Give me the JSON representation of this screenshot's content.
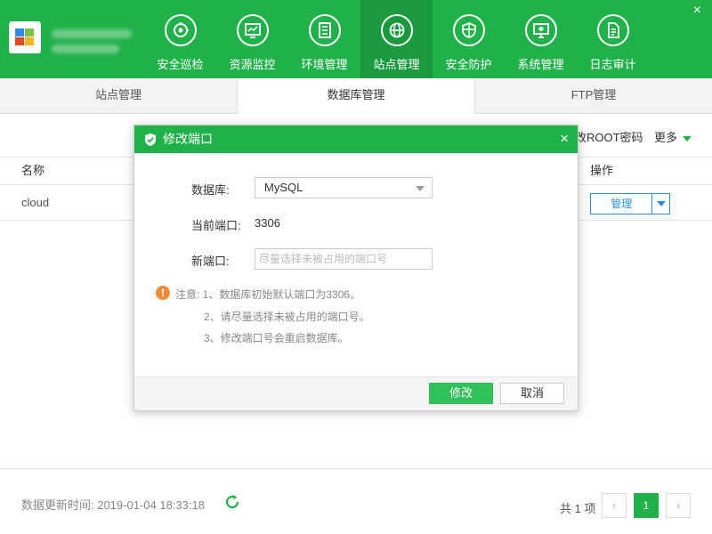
{
  "header": {
    "nav": [
      {
        "label": "安全巡检",
        "icon": "inspection-icon"
      },
      {
        "label": "资源监控",
        "icon": "monitor-icon"
      },
      {
        "label": "环境管理",
        "icon": "server-icon"
      },
      {
        "label": "站点管理",
        "icon": "globe-icon",
        "active": true
      },
      {
        "label": "安全防护",
        "icon": "shield-icon"
      },
      {
        "label": "系统管理",
        "icon": "settings-screen-icon"
      },
      {
        "label": "日志审计",
        "icon": "log-document-icon"
      }
    ],
    "close_label": "×"
  },
  "tabs": [
    {
      "label": "站点管理"
    },
    {
      "label": "数据库管理",
      "active": true
    },
    {
      "label": "FTP管理"
    }
  ],
  "toolbar": {
    "root_pwd_label": "改ROOT密码",
    "more_label": "更多"
  },
  "table": {
    "columns": {
      "name": "名称",
      "op": "操作"
    },
    "rows": [
      {
        "name": "cloud",
        "action": "管理"
      }
    ]
  },
  "footer": {
    "update_time": "数据更新时间: 2019-01-04 18:33:18",
    "total": "共 1 项",
    "prev": "‹",
    "page": "1",
    "next": "›"
  },
  "modal": {
    "title": "修改端口",
    "close": "×",
    "db_label": "数据库:",
    "db_value": "MySQL",
    "current_port_label": "当前端口:",
    "current_port_value": "3306",
    "new_port_label": "新端口:",
    "new_port_placeholder": "尽量选择未被占用的端口号",
    "notice_title": "注意: 1、数据库初始默认端口为3306。",
    "notice_2": "2、请尽量选择未被占用的端口号。",
    "notice_3": "3、修改端口号会重启数据库。",
    "ok": "修改",
    "cancel": "取消"
  },
  "colors": {
    "brand_green": "#21b14a",
    "link_blue": "#2a8fd8",
    "warning_orange": "#f08c35"
  }
}
